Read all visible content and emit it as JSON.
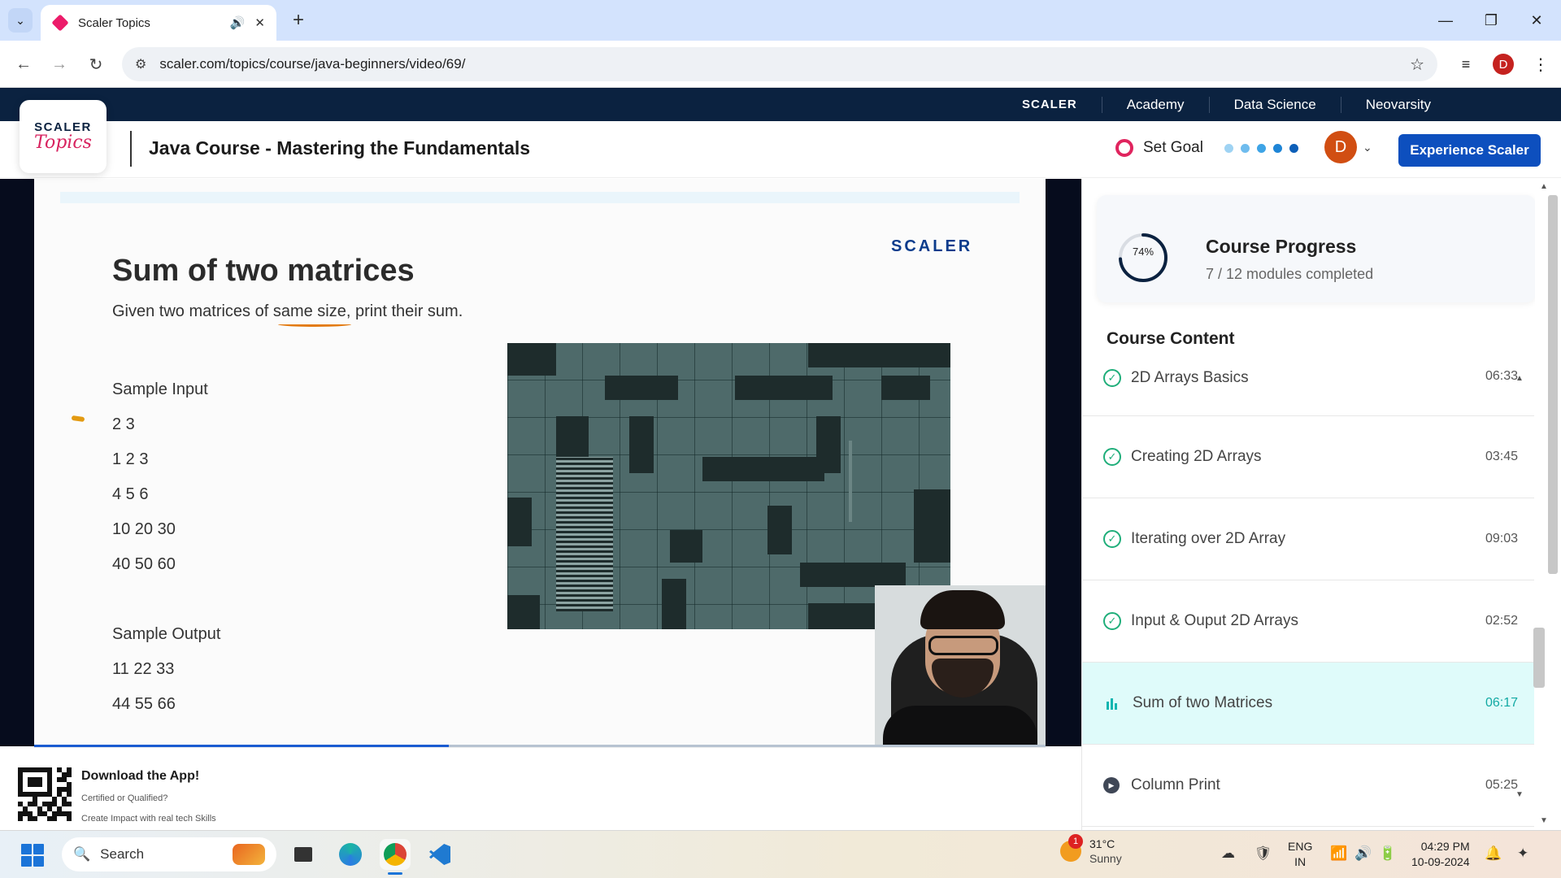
{
  "browser": {
    "tab_title": "Scaler Topics",
    "url": "scaler.com/topics/course/java-beginners/video/69/",
    "profile_initial": "D"
  },
  "topnav": {
    "brand": "SCALER",
    "items": [
      "Academy",
      "Data Science",
      "Neovarsity"
    ]
  },
  "header": {
    "logo_scaler": "SCALER",
    "logo_topics": "Topics",
    "course_title": "Java Course - Mastering the Fundamentals",
    "set_goal_label": "Set Goal",
    "goal_dot_colors": [
      "#9fd3f3",
      "#6fbcee",
      "#3ea4e6",
      "#1e85d6",
      "#0d5fb8"
    ],
    "user_initial": "D",
    "cta_label": "Experience Scaler"
  },
  "slide": {
    "brand": "SCALER",
    "heading": "Sum of two matrices",
    "subtitle": "Given two matrices of same size, print their sum.",
    "lines": [
      "Sample Input",
      "2 3",
      "1 2 3",
      "4 5 6",
      "10 20 30",
      "40 50 60",
      "",
      "Sample Output",
      "11 22 33",
      "44 55 66"
    ],
    "video_progress_fraction": 0.41
  },
  "app_banner": {
    "title": "Download the App!",
    "sub1": "Certified or Qualified?",
    "sub2": "Create Impact with real tech Skills"
  },
  "sidebar": {
    "progress_percent_label": "74%",
    "progress_fraction": 0.74,
    "progress_title": "Course Progress",
    "progress_sub": "7 / 12 modules completed",
    "content_title": "Course Content",
    "lessons": [
      {
        "name": "2D Arrays Basics",
        "time": "06:33",
        "state": "done"
      },
      {
        "name": "Creating 2D Arrays",
        "time": "03:45",
        "state": "done"
      },
      {
        "name": "Iterating over 2D Array",
        "time": "09:03",
        "state": "done"
      },
      {
        "name": "Input & Ouput 2D Arrays",
        "time": "02:52",
        "state": "done"
      },
      {
        "name": "Sum of two Matrices",
        "time": "06:17",
        "state": "playing"
      },
      {
        "name": "Column Print",
        "time": "05:25",
        "state": "next"
      }
    ]
  },
  "taskbar": {
    "search_placeholder": "Search",
    "weather_badge": "1",
    "weather_temp": "31°C",
    "weather_cond": "Sunny",
    "lang_top": "ENG",
    "lang_bottom": "IN",
    "time": "04:29 PM",
    "date": "10-09-2024"
  }
}
